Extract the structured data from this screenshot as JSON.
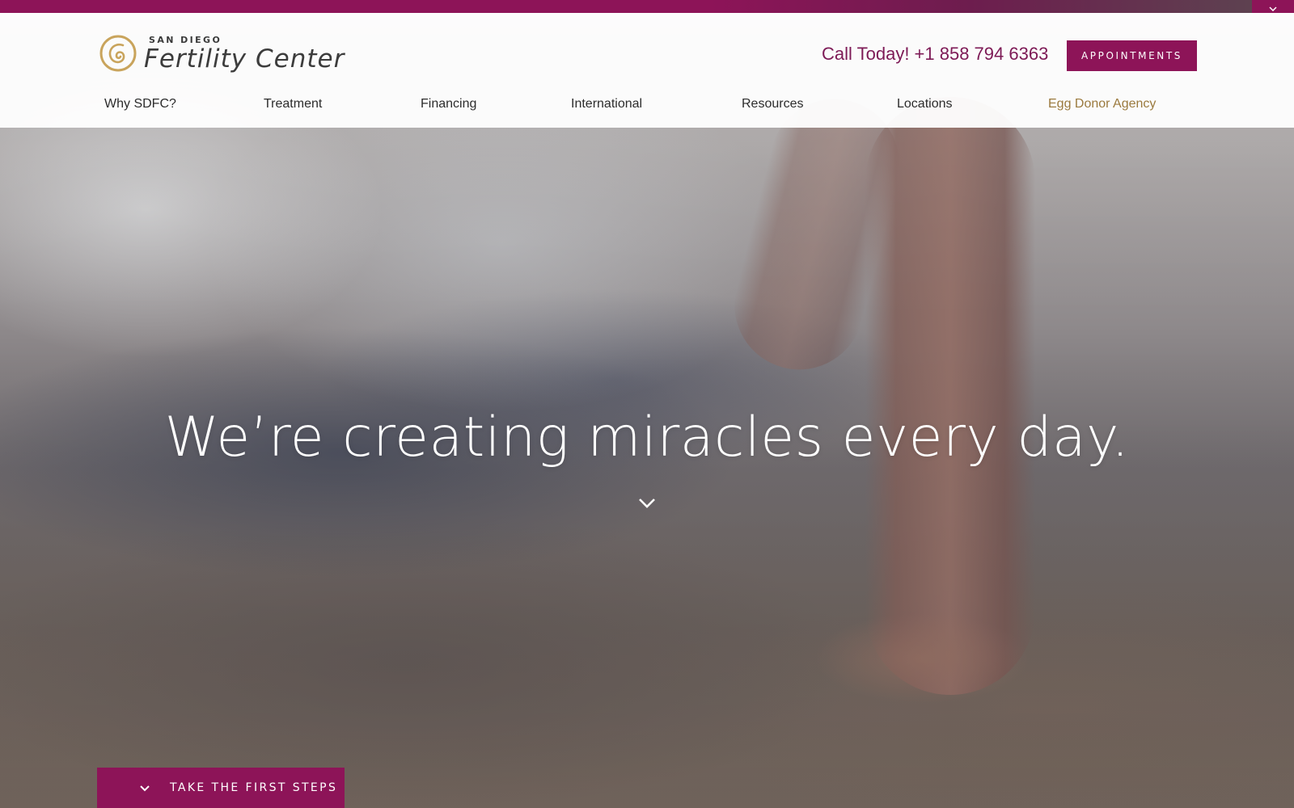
{
  "brand": {
    "name_small": "SAN DIEGO",
    "name_large": "Fertility Center",
    "logo_icon": "spiral-logo-icon",
    "gold_color": "#c9a45c",
    "magenta_color": "#8d1458"
  },
  "header": {
    "phone": "Call Today! +1 858 794 6363",
    "appointments_label": "APPOINTMENTS"
  },
  "nav": {
    "items": [
      {
        "label": "Why SDFC?"
      },
      {
        "label": "Treatment"
      },
      {
        "label": "Financing"
      },
      {
        "label": "International"
      },
      {
        "label": "Resources"
      },
      {
        "label": "Locations"
      },
      {
        "label": "Egg Donor Agency"
      }
    ]
  },
  "hero": {
    "headline": "We’re creating miracles every day.",
    "scroll_icon": "chevron-down-icon"
  },
  "cta": {
    "label": "TAKE THE FIRST STEPS",
    "icon": "chevron-down-icon"
  },
  "top_strip": {
    "toggle_icon": "chevron-down-icon"
  }
}
